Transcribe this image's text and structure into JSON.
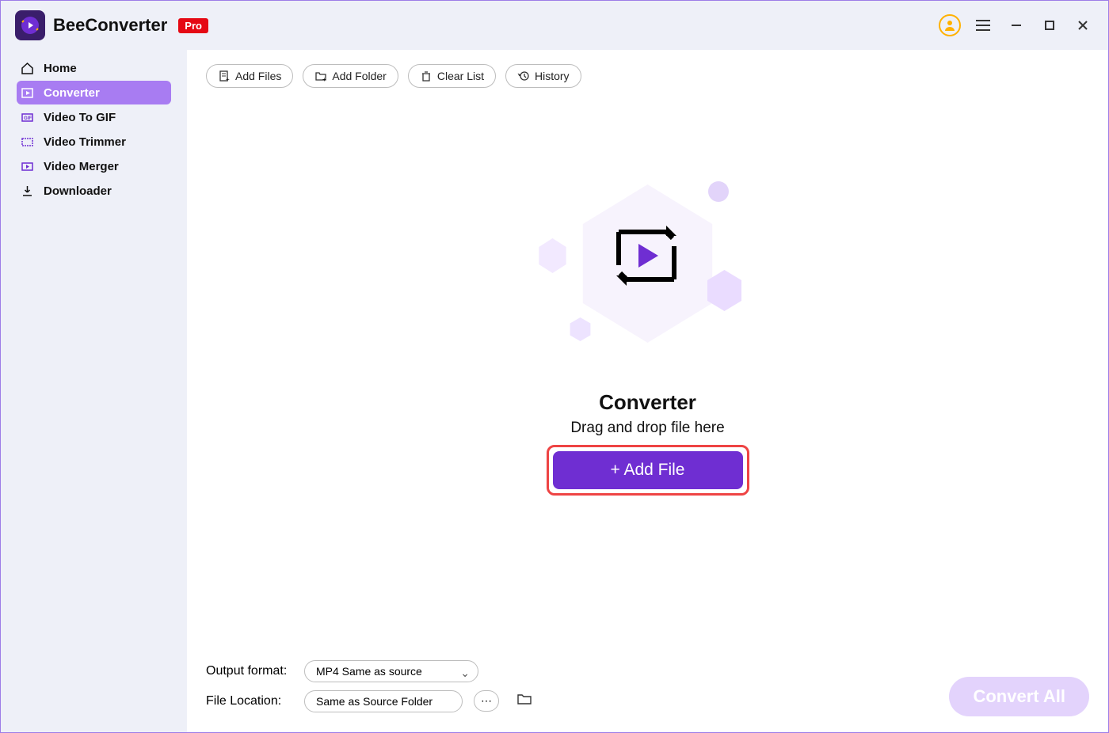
{
  "header": {
    "app_name": "BeeConverter",
    "badge": "Pro"
  },
  "sidebar": {
    "items": [
      {
        "label": "Home",
        "icon": "home-icon"
      },
      {
        "label": "Converter",
        "icon": "converter-icon"
      },
      {
        "label": "Video To GIF",
        "icon": "gif-icon"
      },
      {
        "label": "Video Trimmer",
        "icon": "trimmer-icon"
      },
      {
        "label": "Video Merger",
        "icon": "merger-icon"
      },
      {
        "label": "Downloader",
        "icon": "download-icon"
      }
    ]
  },
  "toolbar": {
    "add_files": "Add Files",
    "add_folder": "Add Folder",
    "clear_list": "Clear List",
    "history": "History"
  },
  "center": {
    "title": "Converter",
    "subtitle": "Drag and drop file here",
    "add_file_button": "+ Add File"
  },
  "footer": {
    "output_format_label": "Output format:",
    "output_format_value": "MP4 Same as source",
    "file_location_label": "File Location:",
    "file_location_value": "Same as Source Folder",
    "convert_all": "Convert All"
  }
}
